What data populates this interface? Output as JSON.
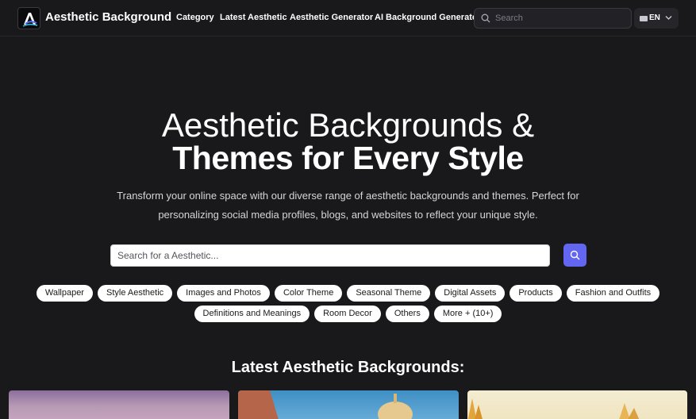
{
  "header": {
    "brand": "Aesthetic Background",
    "nav": [
      "Category",
      "Latest Aesthetic",
      "Aesthetic Generator",
      "AI Background Generator"
    ],
    "search_placeholder": "Search",
    "language": "EN"
  },
  "hero": {
    "title_line1": "Aesthetic Backgrounds &",
    "title_line2": "Themes for Every Style",
    "subtitle": "Transform your online space with our diverse range of aesthetic backgrounds and themes. Perfect for personalizing social media profiles, blogs, and websites to reflect your unique style.",
    "search_placeholder": "Search for a Aesthetic..."
  },
  "tags_row1": [
    "Wallpaper",
    "Style Aesthetic",
    "Images and Photos",
    "Color Theme",
    "Seasonal Theme",
    "Digital Assets",
    "Products",
    "Fashion and Outfits"
  ],
  "tags_row2": [
    "Definitions and Meanings",
    "Room Decor",
    "Others",
    "More + (10+)"
  ],
  "latest": {
    "title": "Latest Aesthetic Backgrounds:"
  },
  "colors": {
    "background": "#19181b",
    "accent": "#6366f1"
  }
}
